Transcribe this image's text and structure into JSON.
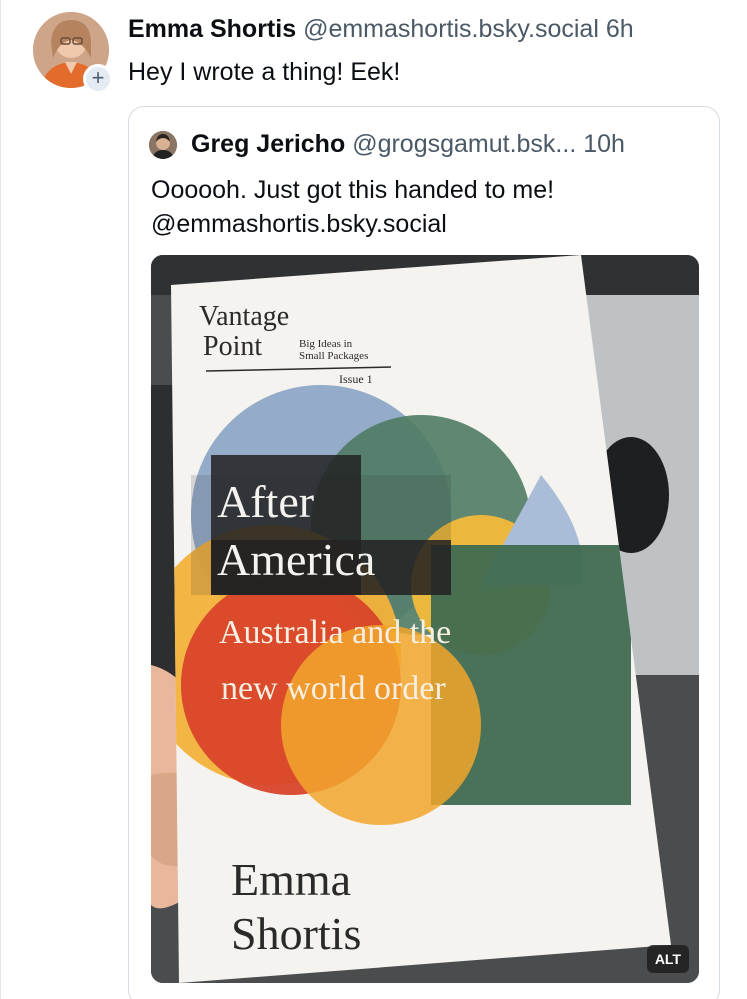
{
  "post": {
    "author_name": "Emma Shortis",
    "author_handle": "@emmashortis.bsky.social",
    "time": "6h",
    "text": "Hey I wrote a thing! Eek!",
    "follow_symbol": "+"
  },
  "quote": {
    "author_name": "Greg Jericho",
    "author_handle": "@grogsgamut.bsk...",
    "time": "10h",
    "text_line1": "Oooooh. Just got this handed to me!",
    "text_line2": "@emmashortis.bsky.social",
    "image_alt_badge": "ALT",
    "book": {
      "series_line1": "Vantage",
      "series_line2": "Point",
      "tagline_line1": "Big Ideas in",
      "tagline_line2": "Small Packages",
      "issue": "Issue 1",
      "title_line1": "After",
      "title_line2": "America",
      "subtitle_line1": "Australia and the",
      "subtitle_line2": "new world order",
      "author_line1": "Emma",
      "author_line2": "Shortis"
    }
  },
  "colors": {
    "text": "#0b0f14",
    "muted": "#4b5866",
    "border": "#d4dbe2"
  }
}
